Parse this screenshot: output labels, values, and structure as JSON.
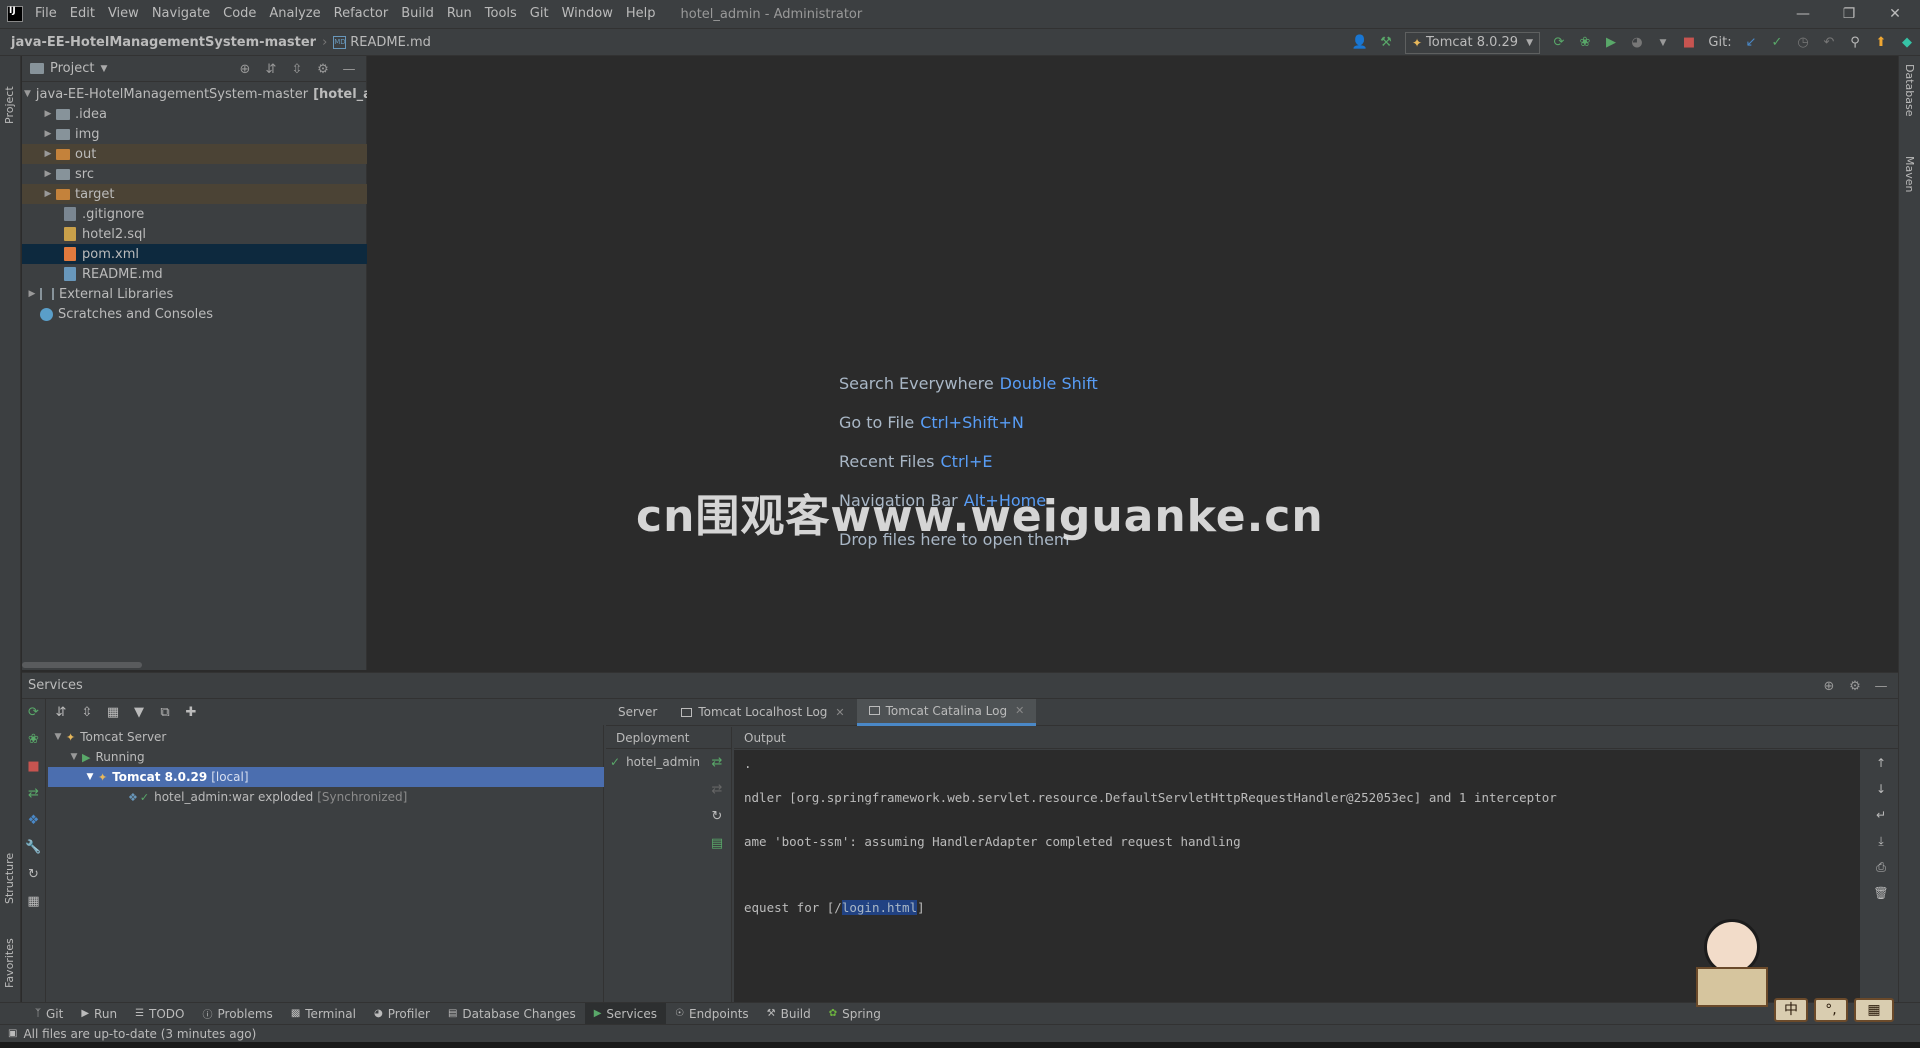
{
  "menu": {
    "items": [
      "File",
      "Edit",
      "View",
      "Navigate",
      "Code",
      "Analyze",
      "Refactor",
      "Build",
      "Run",
      "Tools",
      "Git",
      "Window",
      "Help"
    ],
    "window_title": "hotel_admin - Administrator"
  },
  "navbar": {
    "project": "java-EE-HotelManagementSystem-master",
    "file": "README.md",
    "run_config": "Tomcat 8.0.29",
    "git_label": "Git:"
  },
  "stripes": {
    "left_top": "Project",
    "left_structure": "Structure",
    "left_favorites": "Favorites",
    "right_database": "Database",
    "right_maven": "Maven"
  },
  "project": {
    "title": "Project",
    "root_name": "java-EE-HotelManagementSystem-master",
    "root_suffix": "[hotel_ad",
    "items": [
      {
        "label": ".idea"
      },
      {
        "label": "img"
      },
      {
        "label": "out"
      },
      {
        "label": "src"
      },
      {
        "label": "target"
      },
      {
        "label": ".gitignore"
      },
      {
        "label": "hotel2.sql"
      },
      {
        "label": "pom.xml"
      },
      {
        "label": "README.md"
      }
    ],
    "external_libraries": "External Libraries",
    "scratches": "Scratches and Consoles"
  },
  "editor": {
    "hints": [
      {
        "label": "Search Everywhere",
        "key": "Double Shift"
      },
      {
        "label": "Go to File",
        "key": "Ctrl+Shift+N"
      },
      {
        "label": "Recent Files",
        "key": "Ctrl+E"
      },
      {
        "label": "Navigation Bar",
        "key": "Alt+Home"
      }
    ],
    "drop_text": "Drop files here to open them",
    "watermark": "cn围观客www.weiguanke.cn"
  },
  "services": {
    "title": "Services",
    "tree": {
      "server": "Tomcat Server",
      "running": "Running",
      "instance": "Tomcat 8.0.29",
      "instance_suffix": "[local]",
      "artifact": "hotel_admin:war exploded",
      "artifact_suffix": "[Synchronized]"
    },
    "tabs": [
      "Server",
      "Tomcat Localhost Log",
      "Tomcat Catalina Log"
    ],
    "deployment_header": "Deployment",
    "output_header": "Output",
    "deployment_item": "hotel_admin",
    "console": {
      "line0": ".",
      "line1": "ndler [org.springframework.web.servlet.resource.DefaultServletHttpRequestHandler@252053ec] and 1 interceptor",
      "line2": "ame 'boot-ssm': assuming HandlerAdapter completed request handling",
      "line3_prefix": "equest for [/",
      "line3_highlight": "login.html",
      "line3_suffix": "]"
    }
  },
  "bottom_tabs": [
    "Git",
    "Run",
    "TODO",
    "Problems",
    "Terminal",
    "Profiler",
    "Database Changes",
    "Services",
    "Endpoints",
    "Build",
    "Spring"
  ],
  "status": {
    "text": "All files are up-to-date (3 minutes ago)"
  },
  "ime": {
    "key1": "中",
    "key2": "°,"
  },
  "colors": {
    "accent": "#4a88c7",
    "selection": "#4b6eaf",
    "link_key": "#589df6"
  }
}
